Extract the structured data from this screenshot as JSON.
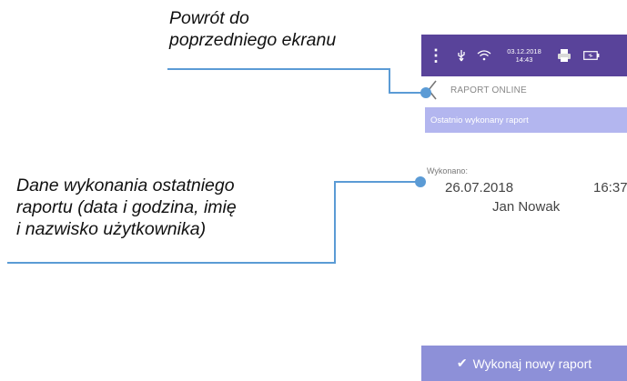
{
  "callouts": {
    "back_line1": "Powrót do",
    "back_line2": "poprzedniego ekranu",
    "data_line1": "Dane wykonania ostatniego",
    "data_line2": "raportu (data i godzina, imię",
    "data_line3": "i nazwisko użytkownika)"
  },
  "status_bar": {
    "date": "03.12.2018",
    "time": "14:43",
    "icons": [
      "menu-dots-icon",
      "usb-icon",
      "wifi-icon",
      "printer-icon",
      "battery-icon"
    ],
    "color": "#59439a"
  },
  "header": {
    "title": "RAPORT ONLINE",
    "back_icon": "chevron-left-icon"
  },
  "section": {
    "title": "Ostatnio wykonany raport",
    "color": "#b3b6ef"
  },
  "last_report": {
    "label": "Wykonano:",
    "date": "26.07.2018",
    "time": "16:37",
    "user": "Jan Nowak"
  },
  "footer": {
    "button_label": "Wykonaj nowy raport",
    "icon": "check-icon",
    "color": "#8d90d8"
  },
  "accent": "#5b9bd5"
}
